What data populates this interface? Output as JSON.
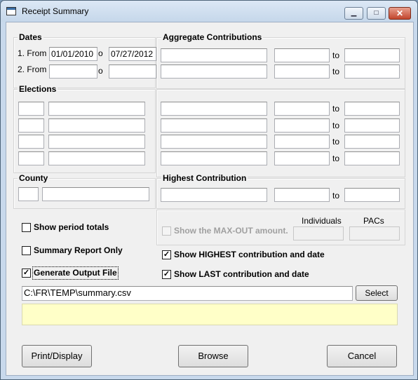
{
  "window": {
    "title": "Receipt Summary",
    "minimize_glyph": "▁",
    "maximize_glyph": "□",
    "close_glyph": "✕"
  },
  "dates": {
    "label": "Dates",
    "row1_prefix": "1.  From",
    "row2_prefix": "2.  From",
    "row1_from": "01/01/2010",
    "row1_to_label": "o",
    "row1_to": "07/27/2012",
    "row2_from": "",
    "row2_to_label": "o",
    "row2_to": ""
  },
  "aggregate": {
    "label": "Aggregate Contributions",
    "to_label": "to",
    "rows": [
      {
        "name": "",
        "from": "",
        "to": ""
      },
      {
        "name": "",
        "from": "",
        "to": ""
      }
    ]
  },
  "elections": {
    "label": "Elections",
    "to_label": "to"
  },
  "county": {
    "label": "County"
  },
  "highest": {
    "label": "Highest Contribution",
    "to_label": "to"
  },
  "maxout": {
    "label": "Show the MAX-OUT amount.",
    "individuals_label": "Individuals",
    "pacs_label": "PACs"
  },
  "options": {
    "show_period_totals": {
      "label": "Show period totals",
      "checked": false
    },
    "summary_report_only": {
      "label": "Summary Report Only",
      "checked": false
    },
    "generate_output_file": {
      "label": "Generate Output File",
      "checked": true
    },
    "show_highest": {
      "label": "Show HIGHEST contribution and date",
      "checked": true
    },
    "show_last": {
      "label": "Show LAST contribution and date",
      "checked": true
    },
    "check_glyph": "✓"
  },
  "output": {
    "path": "C:\\FR\\TEMP\\summary.csv",
    "select_label": "Select"
  },
  "buttons": {
    "print_display": "Print/Display",
    "browse": "Browse",
    "cancel": "Cancel"
  }
}
